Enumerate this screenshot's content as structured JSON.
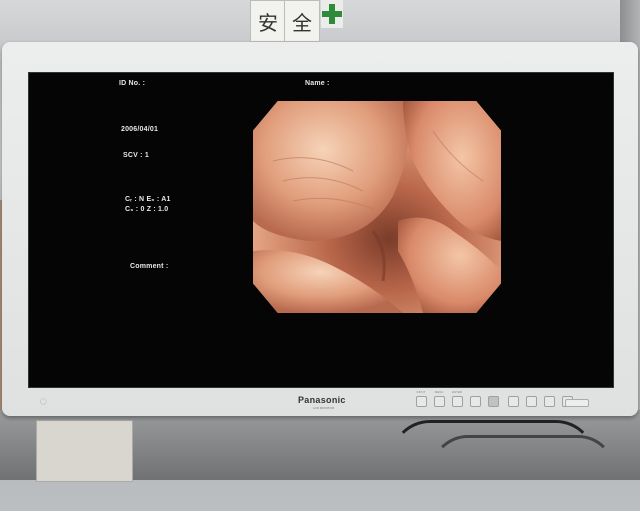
{
  "monitor": {
    "brand": "Panasonic",
    "brand_sub": "LCD MONITOR",
    "front_panel_labels": [
      "INPUT",
      "MENU",
      "ENTER",
      "",
      "",
      "",
      "",
      ""
    ]
  },
  "osd": {
    "id_label": "ID No. :",
    "name_label": "Name :",
    "date": "2006/04/01",
    "scv": "SCV :  1",
    "ce_line": "Cᵣ : N  E₆ : A1",
    "cz_line": "C₆ : 0  Z : 1.0",
    "comment_label": "Comment :"
  },
  "environment": {
    "sign_chars": [
      "安",
      "全"
    ]
  },
  "colors": {
    "bezel": "#e4e6e6",
    "screen": "#050505",
    "osd_text": "#e8e8e8",
    "tissue": "#d98a6a"
  }
}
